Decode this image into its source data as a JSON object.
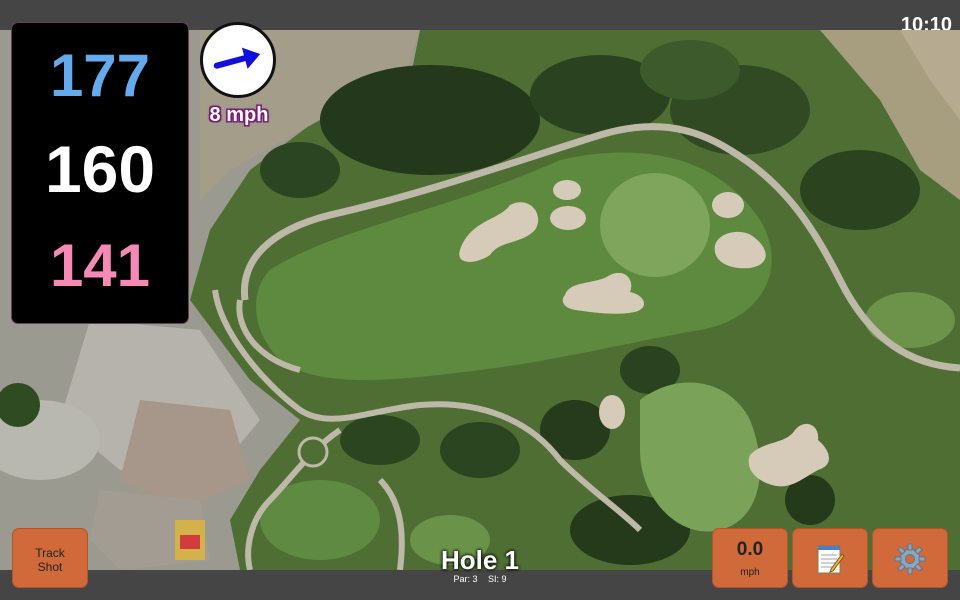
{
  "status_bar": {
    "time": "10:10"
  },
  "distances": {
    "back": "177",
    "center": "160",
    "front": "141"
  },
  "wind": {
    "speed_label": "8 mph",
    "direction_icon": "arrow-icon",
    "direction_degrees": -15
  },
  "buttons": {
    "track_shot_line1": "Track",
    "track_shot_line2": "Shot",
    "windspeed_value": "0.0",
    "windspeed_unit": "mph",
    "scorecard_icon": "notepad-icon",
    "settings_icon": "gear-icon"
  },
  "hole": {
    "title": "Hole 1",
    "par": "Par: 3",
    "si": "SI: 9"
  },
  "colors": {
    "back": "#66aaee",
    "center": "#ffffff",
    "front": "#f58ab7",
    "button": "#d06a3a",
    "bar": "#454545"
  }
}
